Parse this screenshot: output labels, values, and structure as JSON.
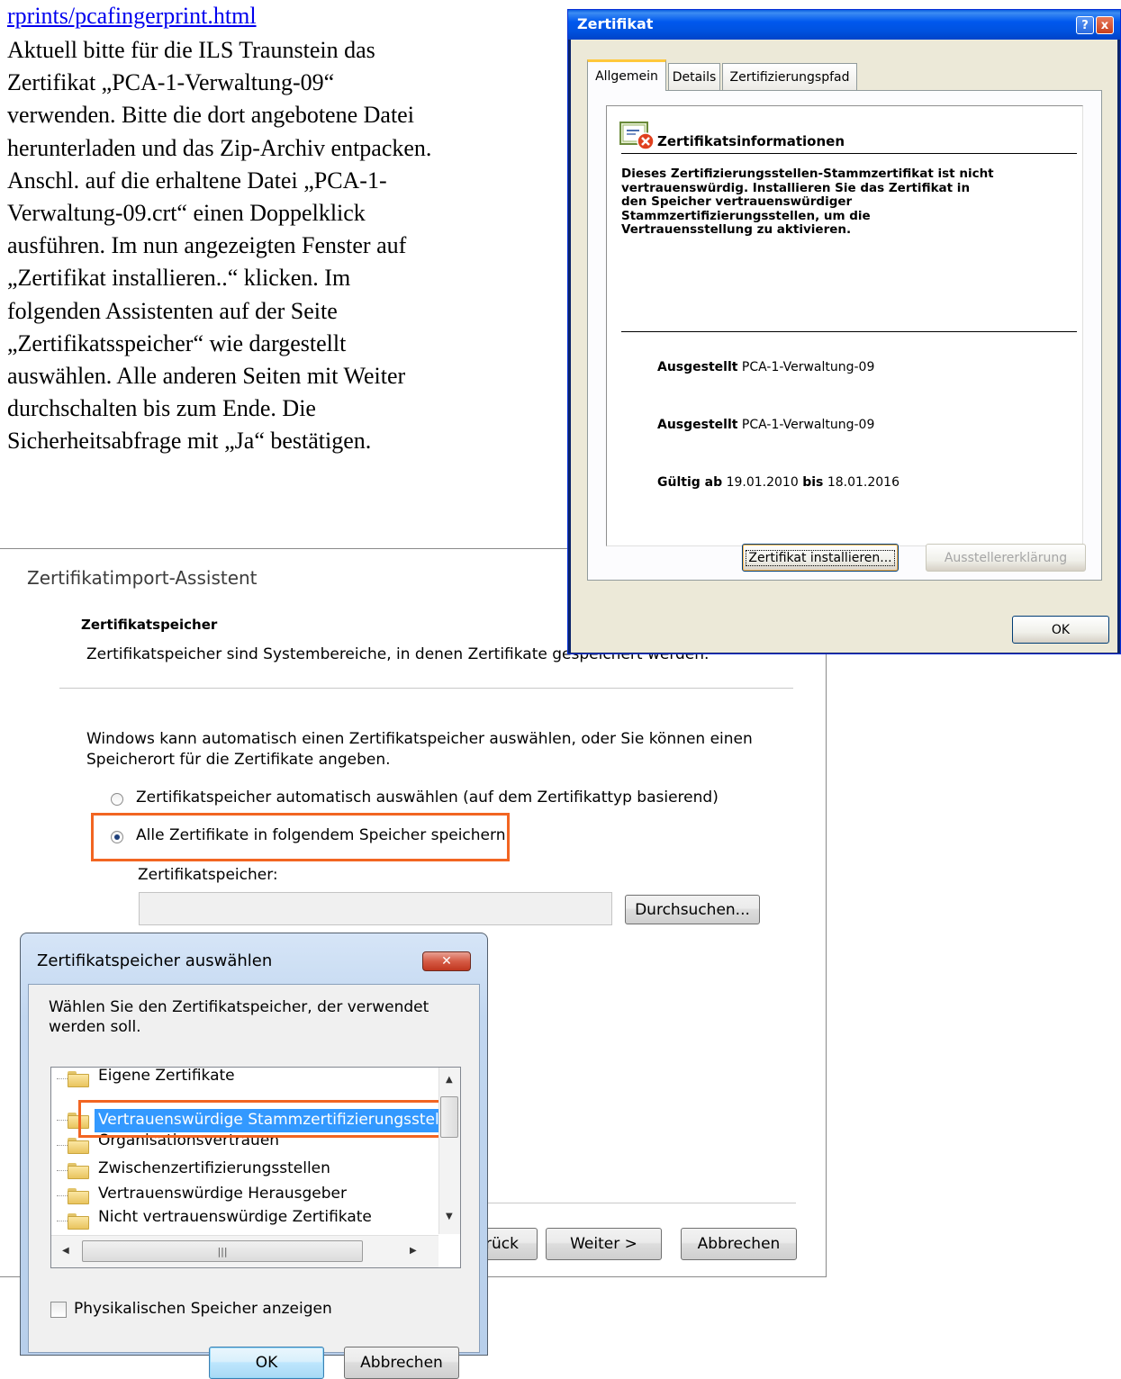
{
  "document": {
    "link_text": "rprints/pcafingerprint.html",
    "paragraph_lines": [
      "Aktuell bitte für die ILS Traunstein das",
      "Zertifikat „PCA-1-Verwaltung-09“",
      "verwenden. Bitte die dort angebotene Datei",
      "herunterladen und das Zip-Archiv entpacken.",
      "Anschl. auf die erhaltene Datei „PCA-1-",
      "Verwaltung-09.crt“ einen Doppelklick",
      "ausführen. Im nun angezeigten Fenster auf",
      "„Zertifikat installieren..“ klicken. Im",
      "folgenden Assistenten auf der Seite",
      "„Zertifikatsspeicher“ wie dargestellt",
      "auswählen. Alle anderen Seiten mit Weiter",
      "durchschalten bis zum Ende. Die",
      "Sicherheitsabfrage mit „Ja“ bestätigen."
    ]
  },
  "wizard": {
    "title": "Zertifikatimport-Assistent",
    "heading": "Zertifikatspeicher",
    "subheading": "Zertifikatspeicher sind Systembereiche, in denen Zertifikate gespeichert werden.",
    "description": "Windows kann automatisch einen Zertifikatspeicher auswählen, oder Sie können einen Speicherort für die Zertifikate angeben.",
    "radio_auto": "Zertifikatspeicher automatisch auswählen (auf dem Zertifikattyp basierend)",
    "radio_manual": "Alle Zertifikate in folgendem Speicher speichern",
    "store_label": "Zertifikatspeicher:",
    "store_value": "",
    "browse_button": "Durchsuchen...",
    "back_button": "< Zurück",
    "back_visible": "rück",
    "next_button": "Weiter >",
    "cancel_button": "Abbrechen"
  },
  "cert_dialog": {
    "title": "Zertifikat",
    "help_icon": "?",
    "close_icon": "x",
    "tabs": [
      "Allgemein",
      "Details",
      "Zertifizierungspfad"
    ],
    "info_title": "Zertifikatsinformationen",
    "warning_lines": [
      "Dieses Zertifizierungsstellen-Stammzertifikat ist nicht",
      "vertrauenswürdig. Installieren Sie das Zertifikat in",
      "den Speicher vertrauenswürdiger",
      "Stammzertifizierungsstellen, um die",
      "Vertrauensstellung zu aktivieren."
    ],
    "issued_to_label": "Ausgestellt",
    "issued_to_value": "PCA-1-Verwaltung-09",
    "issued_by_label": "Ausgestellt",
    "issued_by_value": "PCA-1-Verwaltung-09",
    "valid_from_label": "Gültig ab",
    "valid_from": "19.01.2010",
    "valid_to_label": "bis",
    "valid_to": "18.01.2016",
    "install_button": "Zertifikat installieren...",
    "issuer_statement_button": "Ausstellererklärung",
    "ok_button": "OK"
  },
  "store_dialog": {
    "title": "Zertifikatspeicher auswählen",
    "prompt": "Wählen Sie den Zertifikatspeicher, der verwendet werden soll.",
    "tree_items": [
      "Eigene Zertifikate",
      "Vertrauenswürdige Stammzertifizierungsstellen",
      "Organisationsvertrauen",
      "Zwischenzertifizierungsstellen",
      "Vertrauenswürdige Herausgeber",
      "Nicht vertrauenswürdige Zertifikate"
    ],
    "selected_index": 1,
    "show_physical_label": "Physikalischen Speicher anzeigen",
    "ok_button": "OK",
    "cancel_button": "Abbrechen",
    "highlight_color": "#f26522",
    "selection_color": "#3399ff"
  }
}
